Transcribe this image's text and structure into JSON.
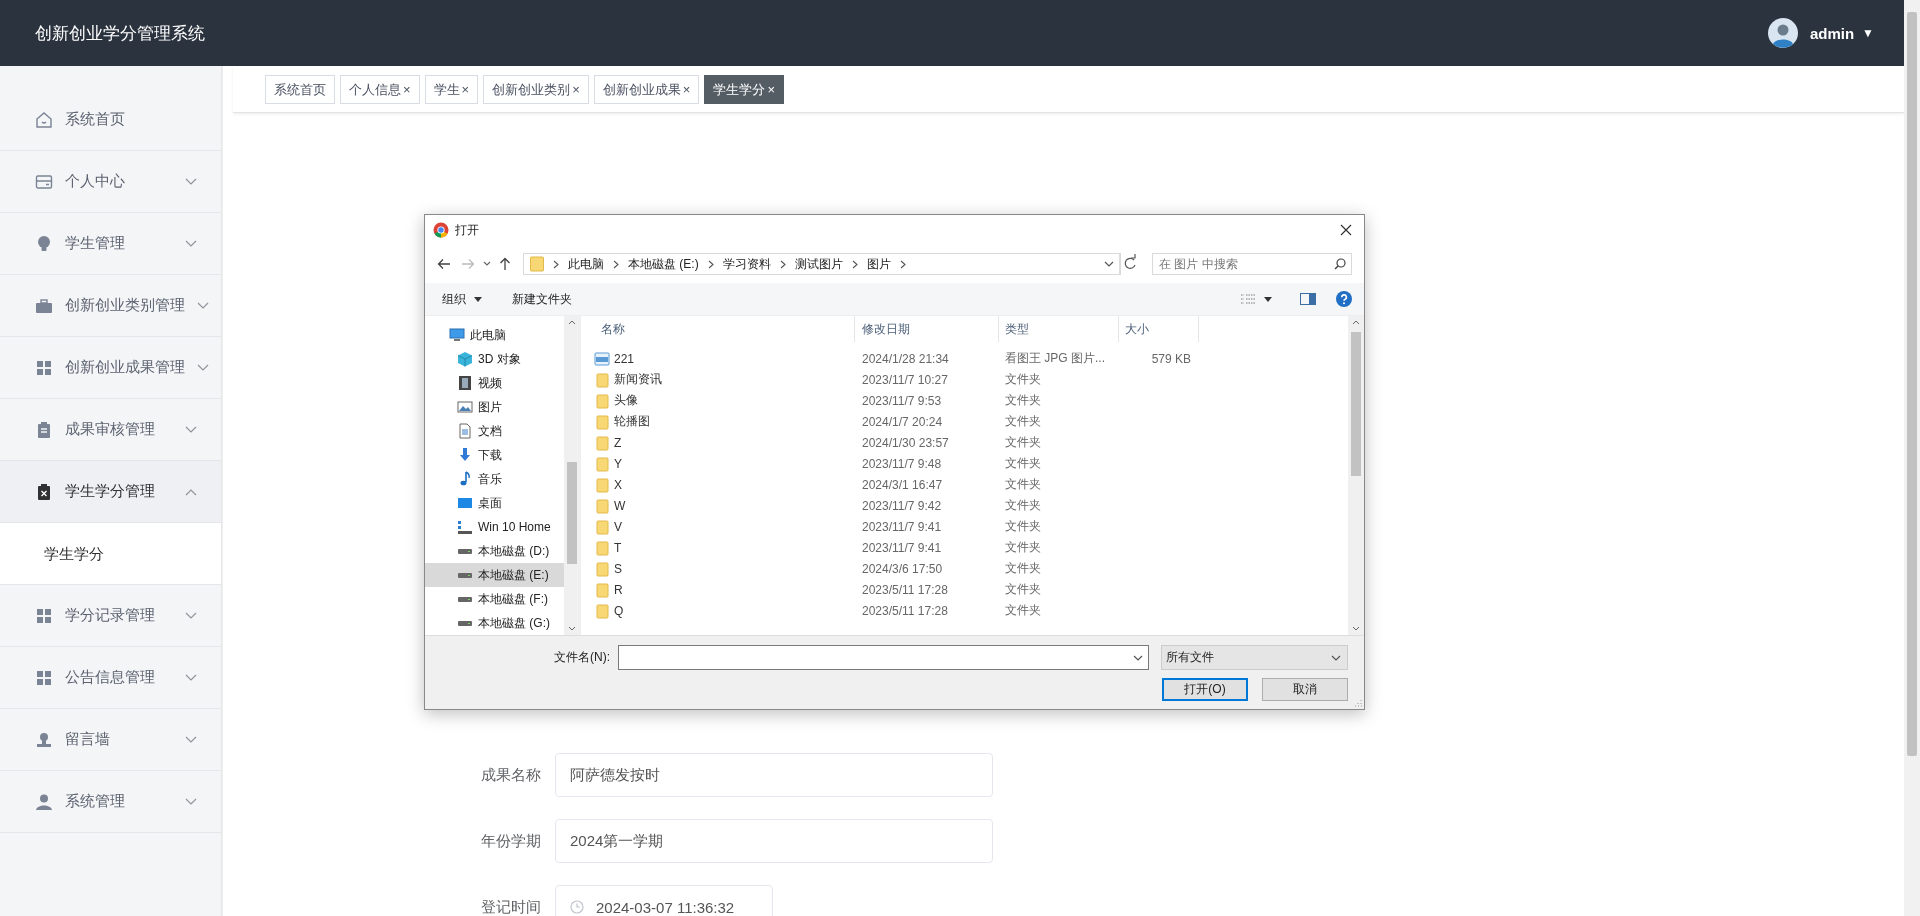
{
  "app": {
    "title": "创新创业学分管理系统",
    "user": "admin",
    "user_caret": "▼"
  },
  "tabs": [
    {
      "label": "系统首页",
      "selected": false
    },
    {
      "label": "个人信息",
      "close": "×",
      "selected": false
    },
    {
      "label": "学生",
      "close": "×",
      "selected": false
    },
    {
      "label": "创新创业类别",
      "close": "×",
      "selected": false
    },
    {
      "label": "创新创业成果",
      "close": "×",
      "selected": false
    },
    {
      "label": "学生学分",
      "close": "×",
      "selected": true
    }
  ],
  "sidebar": {
    "items": [
      {
        "label": "系统首页"
      },
      {
        "label": "个人中心",
        "expanded": false
      },
      {
        "label": "学生管理",
        "expanded": false
      },
      {
        "label": "创新创业类别管理",
        "expanded": false
      },
      {
        "label": "创新创业成果管理",
        "expanded": false
      },
      {
        "label": "成果审核管理",
        "expanded": false
      },
      {
        "label": "学生学分管理",
        "expanded": true,
        "children": [
          {
            "label": "学生学分",
            "selected": true
          }
        ]
      },
      {
        "label": "学分记录管理",
        "expanded": false
      },
      {
        "label": "公告信息管理",
        "expanded": false
      },
      {
        "label": "留言墙",
        "expanded": false
      },
      {
        "label": "系统管理",
        "expanded": false
      }
    ]
  },
  "form": {
    "fields": [
      {
        "label": "成果名称",
        "value": "阿萨德发按时",
        "kind": "text"
      },
      {
        "label": "年份学期",
        "value": "2024第一学期",
        "kind": "text"
      },
      {
        "label": "登记时间",
        "value": "2024-03-07 11:36:32",
        "kind": "datetime"
      }
    ]
  },
  "dialog": {
    "title": "打开",
    "breadcrumb": [
      "此电脑",
      "本地磁盘 (E:)",
      "学习资料",
      "测试图片",
      "图片"
    ],
    "search": {
      "placeholder": "在 图片 中搜索"
    },
    "toolbar": {
      "organize": "组织",
      "new_folder": "新建文件夹"
    },
    "tree": [
      {
        "label": "此电脑",
        "selected": false,
        "children": [
          {
            "label": "3D 对象",
            "selected": false
          },
          {
            "label": "视频",
            "selected": false
          },
          {
            "label": "图片",
            "selected": false
          },
          {
            "label": "文档",
            "selected": false
          },
          {
            "label": "下载",
            "selected": false
          },
          {
            "label": "音乐",
            "selected": false
          },
          {
            "label": "桌面",
            "selected": false
          },
          {
            "label": "Win 10 Home",
            "selected": false
          },
          {
            "label": "本地磁盘 (D:)",
            "selected": false
          },
          {
            "label": "本地磁盘 (E:)",
            "selected": true
          },
          {
            "label": "本地磁盘 (F:)",
            "selected": false
          },
          {
            "label": "本地磁盘 (G:)",
            "selected": false
          }
        ]
      }
    ],
    "columns": [
      "名称",
      "修改日期",
      "类型",
      "大小"
    ],
    "files": [
      {
        "name": "221",
        "kind": "image",
        "modified": "2024/1/28 21:34",
        "type": "看图王 JPG 图片...",
        "size": "579 KB"
      },
      {
        "name": "新闻资讯",
        "kind": "folder",
        "modified": "2023/11/7 10:27",
        "type": "文件夹"
      },
      {
        "name": "头像",
        "kind": "folder",
        "modified": "2023/11/7 9:53",
        "type": "文件夹"
      },
      {
        "name": "轮播图",
        "kind": "folder",
        "modified": "2024/1/7 20:24",
        "type": "文件夹"
      },
      {
        "name": "Z",
        "kind": "folder",
        "modified": "2024/1/30 23:57",
        "type": "文件夹"
      },
      {
        "name": "Y",
        "kind": "folder",
        "modified": "2023/11/7 9:48",
        "type": "文件夹"
      },
      {
        "name": "X",
        "kind": "folder",
        "modified": "2024/3/1 16:47",
        "type": "文件夹"
      },
      {
        "name": "W",
        "kind": "folder",
        "modified": "2023/11/7 9:42",
        "type": "文件夹"
      },
      {
        "name": "V",
        "kind": "folder",
        "modified": "2023/11/7 9:41",
        "type": "文件夹"
      },
      {
        "name": "T",
        "kind": "folder",
        "modified": "2023/11/7 9:41",
        "type": "文件夹"
      },
      {
        "name": "S",
        "kind": "folder",
        "modified": "2024/3/6 17:50",
        "type": "文件夹"
      },
      {
        "name": "R",
        "kind": "folder",
        "modified": "2023/5/11 17:28",
        "type": "文件夹"
      },
      {
        "name": "Q",
        "kind": "folder",
        "modified": "2023/5/11 17:28",
        "type": "文件夹"
      }
    ],
    "filename": {
      "label": "文件名(N):"
    },
    "filter": "所有文件",
    "buttons": [
      {
        "label": "打开(O)",
        "default": true
      },
      {
        "label": "取消",
        "default": false
      }
    ]
  }
}
